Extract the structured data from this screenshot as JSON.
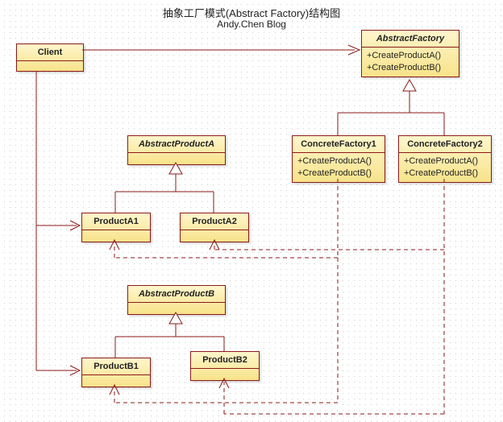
{
  "title": "抽象工厂模式(Abstract Factory)结构图",
  "subtitle": "Andy.Chen Blog",
  "boxes": {
    "client": {
      "name": "Client"
    },
    "absFactory": {
      "name": "AbstractFactory",
      "m1": "+CreateProductA()",
      "m2": "+CreateProductB()"
    },
    "cf1": {
      "name": "ConcreteFactory1",
      "m1": "+CreateProductA()",
      "m2": "+CreateProductB()"
    },
    "cf2": {
      "name": "ConcreteFactory2",
      "m1": "+CreateProductA()",
      "m2": "+CreateProductB()"
    },
    "apA": {
      "name": "AbstractProductA"
    },
    "pA1": {
      "name": "ProductA1"
    },
    "pA2": {
      "name": "ProductA2"
    },
    "apB": {
      "name": "AbstractProductB"
    },
    "pB1": {
      "name": "ProductB1"
    },
    "pB2": {
      "name": "ProductB2"
    }
  }
}
